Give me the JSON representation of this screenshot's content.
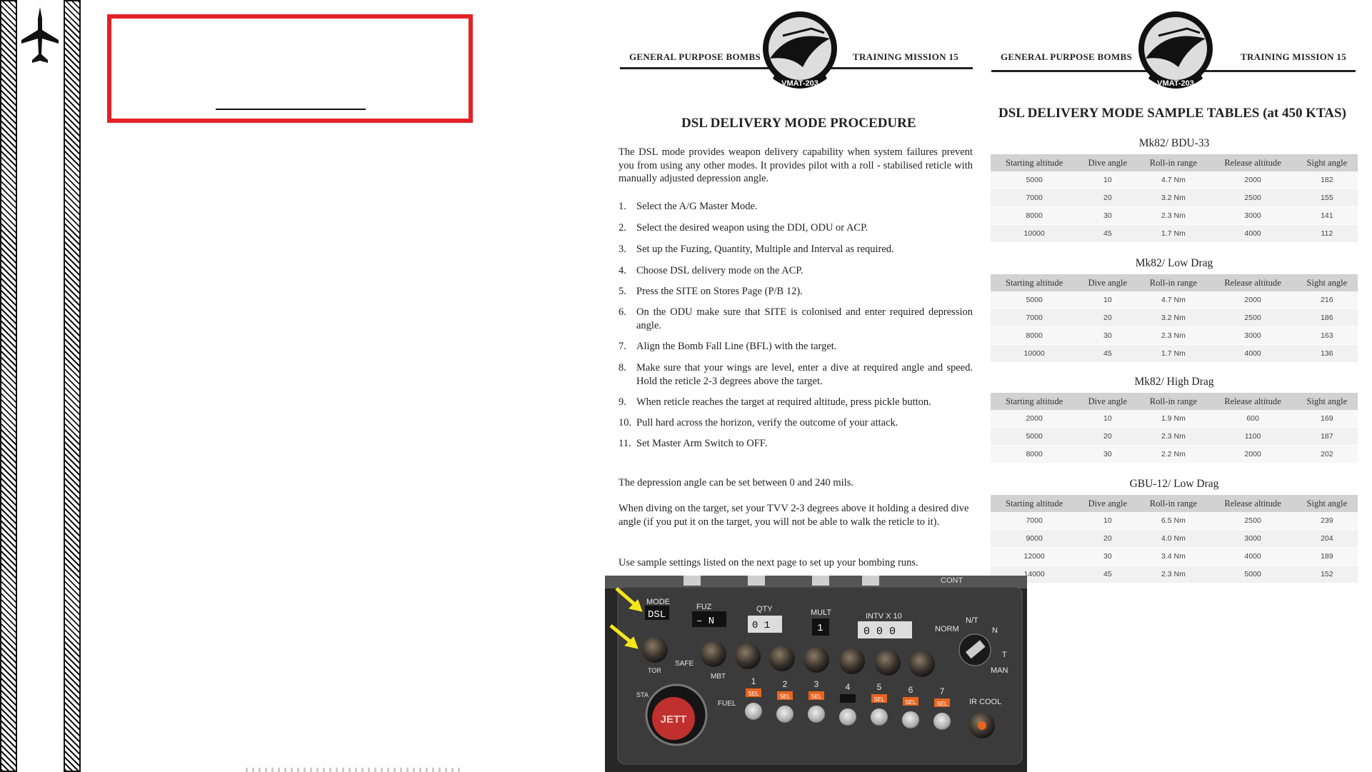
{
  "left_page": {
    "header_left": "GENERAL PURPOSE BOMBS",
    "header_right": "TRAINING MISSION 15",
    "emblem_text": "VMAT-203",
    "title": "DSL DELIVERY MODE PROCEDURE",
    "intro": "The DSL mode provides weapon delivery capability when system failures prevent you from using any other modes. It provides pilot with a roll - stabilised reticle with manually adjusted depression angle.",
    "steps": [
      {
        "n": "1.",
        "text": "Select the A/G Master Mode."
      },
      {
        "n": "2.",
        "text": "Select the desired weapon using the DDI, ODU or ACP."
      },
      {
        "n": "3.",
        "text": "Set up the Fuzing, Quantity, Multiple and Interval as required."
      },
      {
        "n": "4.",
        "text": "Choose DSL delivery mode on the ACP."
      },
      {
        "n": "5.",
        "text": "Press the SITE on Stores Page (P/B 12)."
      },
      {
        "n": "6.",
        "text": "On the ODU make sure that SITE is colonised and enter required depression angle."
      },
      {
        "n": "7.",
        "text": "Align the Bomb Fall Line (BFL) with the target."
      },
      {
        "n": "8.",
        "text": "Make sure that your wings are level, enter a dive at required angle and speed. Hold the reticle 2-3 degrees above the target."
      },
      {
        "n": "9.",
        "text": "When reticle reaches the target at required altitude, press pickle button."
      },
      {
        "n": "10.",
        "text": "Pull hard across the horizon, verify the outcome of your attack."
      },
      {
        "n": "11.",
        "text": "Set Master Arm Switch to OFF."
      }
    ],
    "note1": "The depression angle can be set between 0 and 240 mils.",
    "note2": "When diving on the target, set your TVV 2-3 degrees above it holding a desired dive angle (if you put it on the target, you will not be able to walk the reticle to it).",
    "note3": "Use sample settings listed on the next page to set up your bombing runs."
  },
  "right_page": {
    "header_left": "GENERAL PURPOSE BOMBS",
    "header_right": "TRAINING MISSION 15",
    "emblem_text": "VMAT-203",
    "title": "DSL DELIVERY MODE SAMPLE TABLES (at 450 KTAS)",
    "columns": [
      "Starting altitude",
      "Dive angle",
      "Roll-in range",
      "Release altitude",
      "Sight angle"
    ],
    "tables": [
      {
        "title": "Mk82/ BDU-33",
        "rows": [
          [
            "5000",
            "10",
            "4.7 Nm",
            "2000",
            "182"
          ],
          [
            "7000",
            "20",
            "3.2 Nm",
            "2500",
            "155"
          ],
          [
            "8000",
            "30",
            "2.3 Nm",
            "3000",
            "141"
          ],
          [
            "10000",
            "45",
            "1.7 Nm",
            "4000",
            "112"
          ]
        ]
      },
      {
        "title": "Mk82/ Low Drag",
        "rows": [
          [
            "5000",
            "10",
            "4.7 Nm",
            "2000",
            "216"
          ],
          [
            "7000",
            "20",
            "3.2 Nm",
            "2500",
            "186"
          ],
          [
            "8000",
            "30",
            "2.3 Nm",
            "3000",
            "163"
          ],
          [
            "10000",
            "45",
            "1.7 Nm",
            "4000",
            "136"
          ]
        ]
      },
      {
        "title": "Mk82/ High Drag",
        "rows": [
          [
            "2000",
            "10",
            "1.9 Nm",
            "600",
            "169"
          ],
          [
            "5000",
            "20",
            "2.3 Nm",
            "1100",
            "187"
          ],
          [
            "8000",
            "30",
            "2.2 Nm",
            "2000",
            "202"
          ]
        ]
      },
      {
        "title": "GBU-12/ Low Drag",
        "rows": [
          [
            "7000",
            "10",
            "6.5 Nm",
            "2500",
            "239"
          ],
          [
            "9000",
            "20",
            "4.0 Nm",
            "3000",
            "204"
          ],
          [
            "12000",
            "30",
            "3.4 Nm",
            "4000",
            "189"
          ],
          [
            "14000",
            "45",
            "2.3 Nm",
            "5000",
            "152"
          ]
        ]
      }
    ]
  },
  "panel": {
    "mode_label": "MODE",
    "mode_value": "DSL",
    "fuz_label": "FUZ",
    "fuz_value": "– N",
    "qty_label": "QTY",
    "qty_value": "0 1",
    "mult_label": "MULT",
    "mult_value": "1",
    "intv_label": "INTV  X 10",
    "intv_value": "0 0 0",
    "norm_label": "NORM",
    "nt_label": "N/T",
    "n_label": "N",
    "t_label": "T",
    "man_label": "MAN",
    "safe_label": "SAFE",
    "mbt_label": "MBT",
    "fuel_label": "FUEL",
    "tor_label": "TOR",
    "sta_label": "STA",
    "cont_label": "CONT",
    "jett_label": "JETT",
    "ircool_label": "IR  COOL",
    "sel_label": "SEL",
    "stations": [
      "1",
      "2",
      "3",
      "4",
      "5",
      "6",
      "7"
    ],
    "arrow_color": "#f5e61b",
    "sel_color": "#e8641e"
  },
  "colors": {
    "frame_red": "#e32227"
  }
}
